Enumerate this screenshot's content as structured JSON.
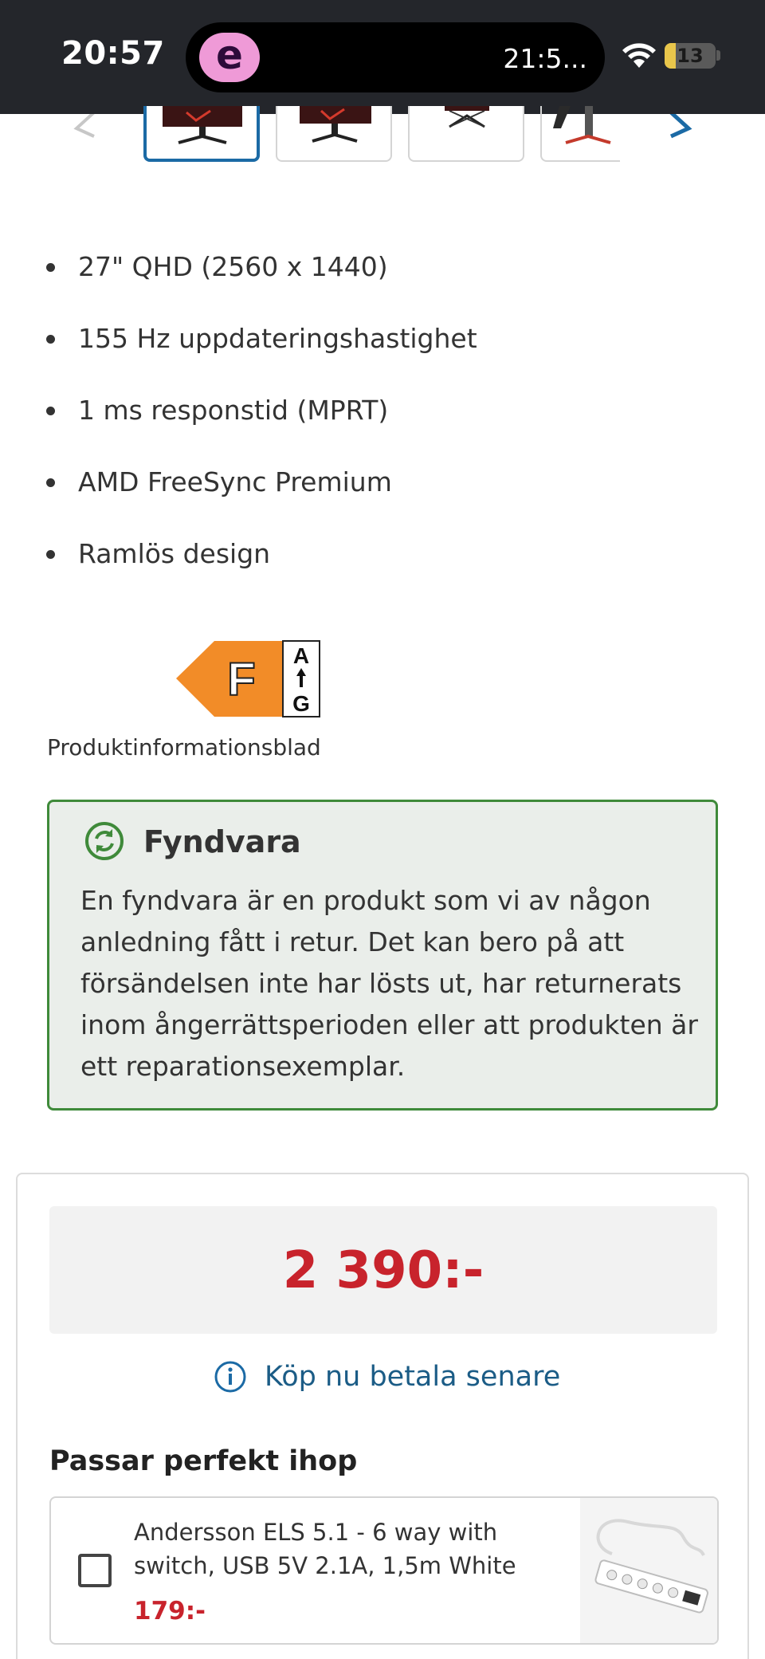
{
  "status_bar": {
    "time": "20:57",
    "island_app_letter": "e",
    "island_time": "21:5...",
    "battery_level": "13",
    "wifi_icon": "wifi-icon"
  },
  "gallery": {
    "thumbnail_count_visible": 4,
    "active_index": 0,
    "prev_icon": "chevron-left-icon",
    "next_icon": "chevron-right-icon"
  },
  "features": [
    "27\" QHD (2560 x 1440)",
    "155 Hz uppdateringshastighet",
    "1 ms responstid (MPRT)",
    "AMD FreeSync Premium",
    "Ramlös design"
  ],
  "energy_label": {
    "class": "F",
    "scale_top": "A",
    "scale_bottom": "G",
    "color": "#f28c28"
  },
  "product_sheet_link": "Produktinformationsblad",
  "fyndvara": {
    "title": "Fyndvara",
    "text": "En fyndvara är en produkt som vi av någon anledning fått i retur. Det kan bero på att försändelsen inte har lösts ut, har returnerats inom ångerrättsperioden eller att produkten är ett reparationsexemplar.",
    "accent": "#3f8a3a"
  },
  "purchase": {
    "price": "2 390:-",
    "price_color": "#c8232c",
    "buy_now_pay_later": "Köp nu betala senare"
  },
  "pairs": {
    "title": "Passar perfekt ihop",
    "items": [
      {
        "name": "Andersson ELS 5.1 - 6 way with switch, USB 5V 2.1A, 1,5m White",
        "price": "179:-",
        "checked": false
      }
    ]
  }
}
